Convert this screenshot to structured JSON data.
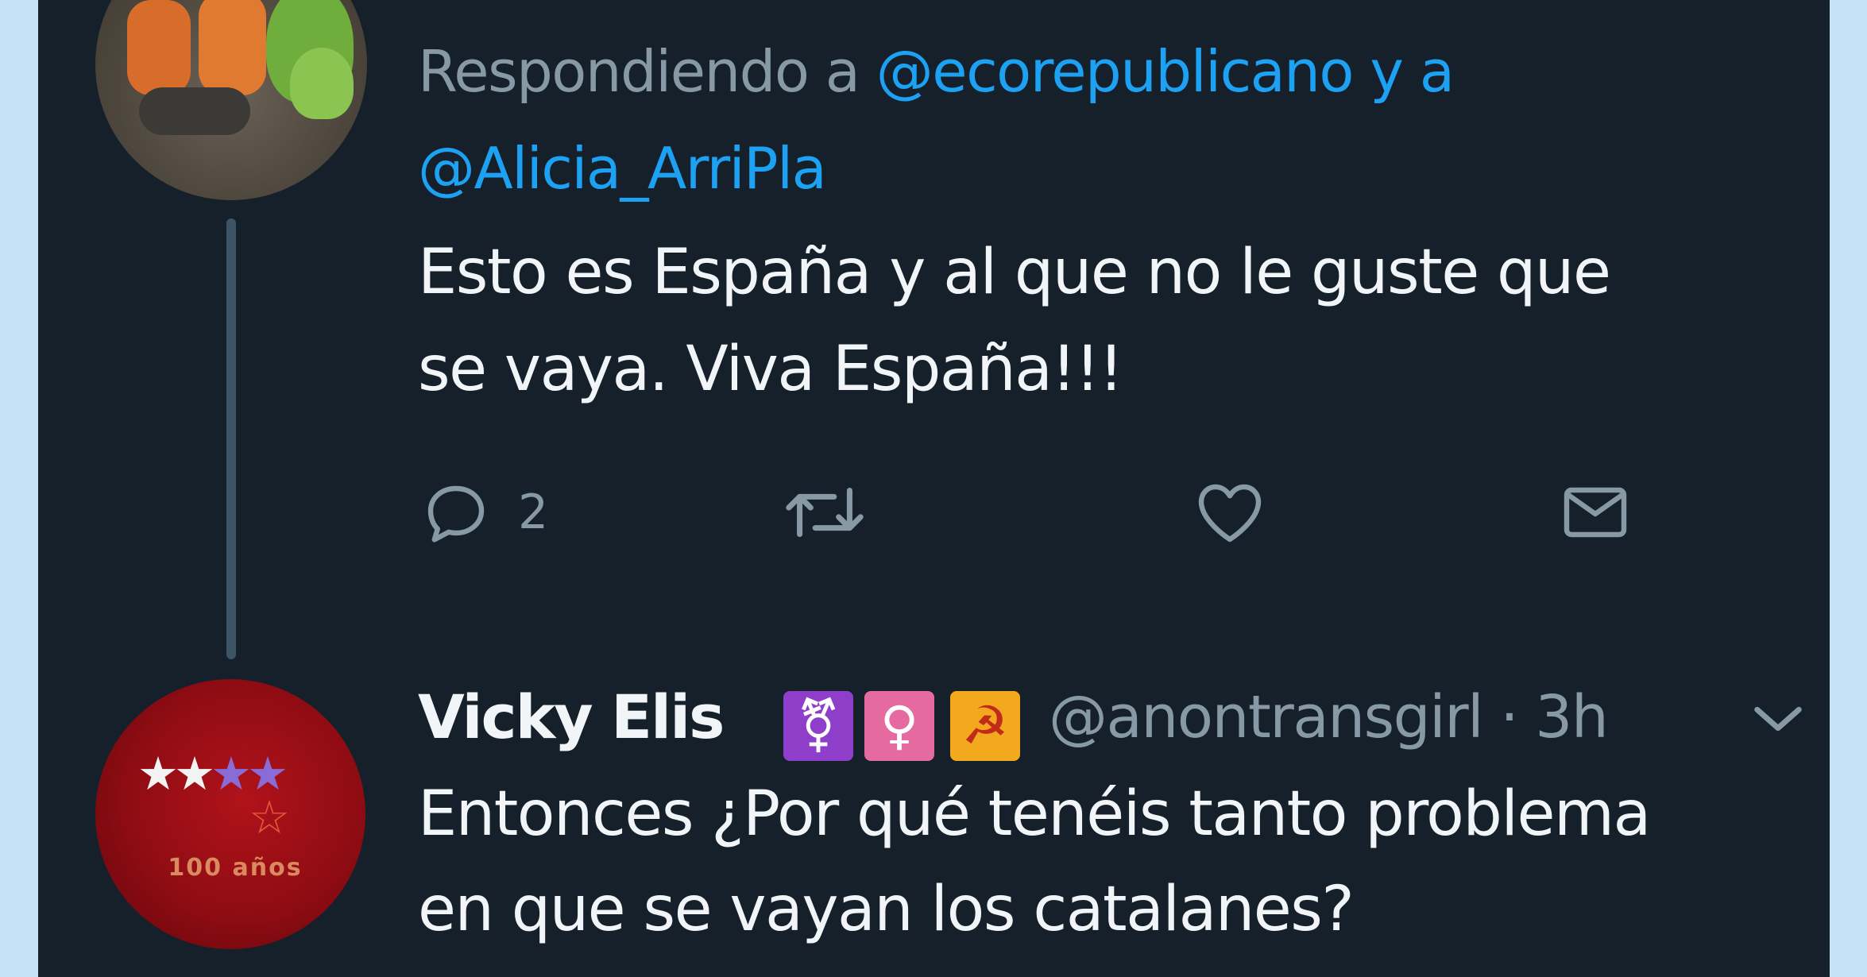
{
  "tweet_top": {
    "replying_prefix": "Respondiendo a ",
    "handle_1": "@ecorepublicano",
    "joiner": " y a",
    "handle_2": "@Alicia_ArriPla",
    "text_line_1": "Esto es España y al que no le guste que",
    "text_line_2": "se vaya. Viva España!!!",
    "reply_count": "2",
    "icons": [
      "reply-icon",
      "retweet-icon",
      "like-icon",
      "direct-message-icon"
    ]
  },
  "tweet_bottom": {
    "display_name": "Vicky Elis",
    "badges": [
      {
        "icon": "transgender-symbol-icon",
        "glyph": "⚧",
        "color": "#8e3ec8"
      },
      {
        "icon": "female-symbol-icon",
        "glyph": "♀",
        "color": "#e46aa0"
      },
      {
        "icon": "hammer-sickle-icon",
        "glyph": "☭",
        "color": "#f2a91d"
      }
    ],
    "handle": "@anontransgirl",
    "time": "· 3h",
    "text_line_1": "Entonces ¿Por qué tenéis tanto problema",
    "text_line_2": "en que se vayan los catalanes?"
  },
  "avatar_bottom_motto": "100 años",
  "colors": {
    "background": "#15202b",
    "outer": "#c4e3f6",
    "link": "#1da1f2",
    "muted": "#8899a6",
    "text": "#f2f5f7"
  }
}
